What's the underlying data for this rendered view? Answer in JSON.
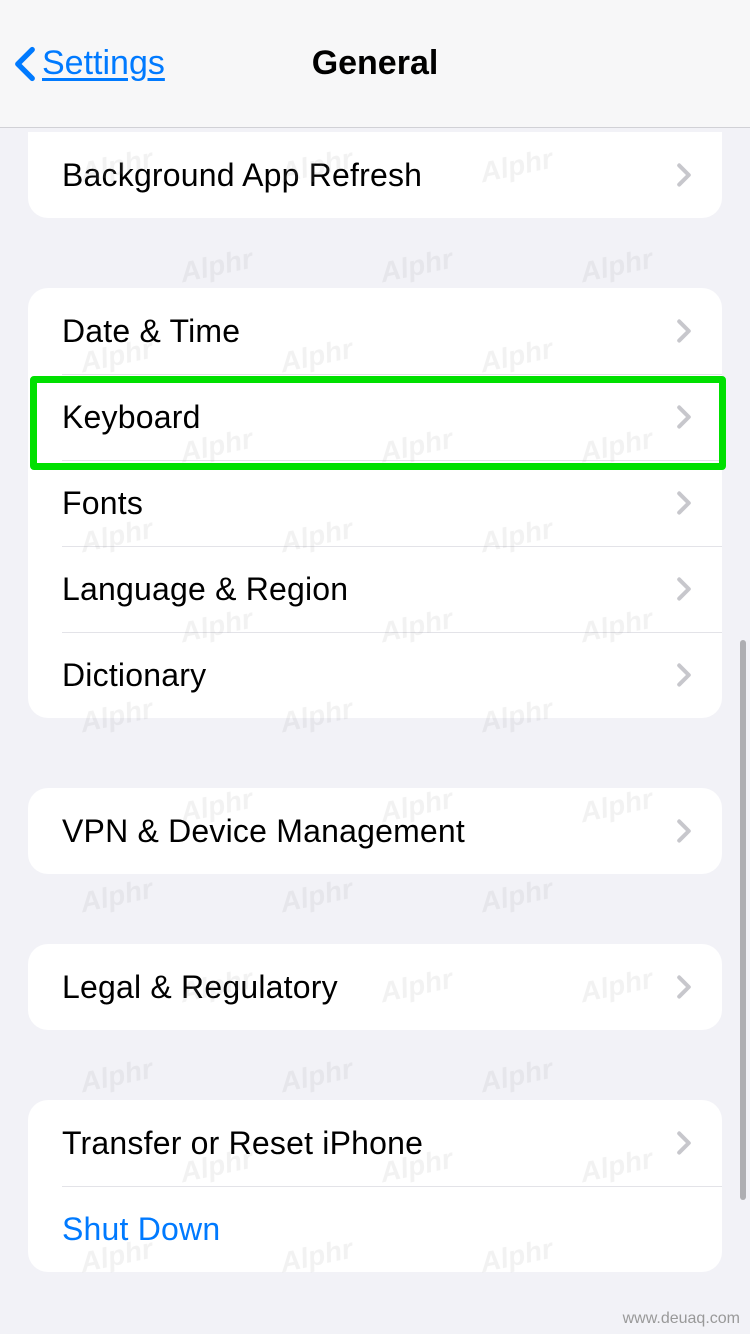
{
  "nav": {
    "back_label": "Settings",
    "title": "General"
  },
  "groups": [
    {
      "rows": [
        {
          "label": "Background App Refresh",
          "disclosure": true
        }
      ]
    },
    {
      "rows": [
        {
          "label": "Date & Time",
          "disclosure": true
        },
        {
          "label": "Keyboard",
          "disclosure": true,
          "highlighted": true
        },
        {
          "label": "Fonts",
          "disclosure": true
        },
        {
          "label": "Language & Region",
          "disclosure": true
        },
        {
          "label": "Dictionary",
          "disclosure": true
        }
      ]
    },
    {
      "rows": [
        {
          "label": "VPN & Device Management",
          "disclosure": true
        }
      ]
    },
    {
      "rows": [
        {
          "label": "Legal & Regulatory",
          "disclosure": true
        }
      ]
    },
    {
      "rows": [
        {
          "label": "Transfer or Reset iPhone",
          "disclosure": true
        },
        {
          "label": "Shut Down",
          "disclosure": false,
          "blue": true
        }
      ]
    }
  ],
  "watermark_text": "Alphr",
  "footer_url": "www.deuaq.com"
}
